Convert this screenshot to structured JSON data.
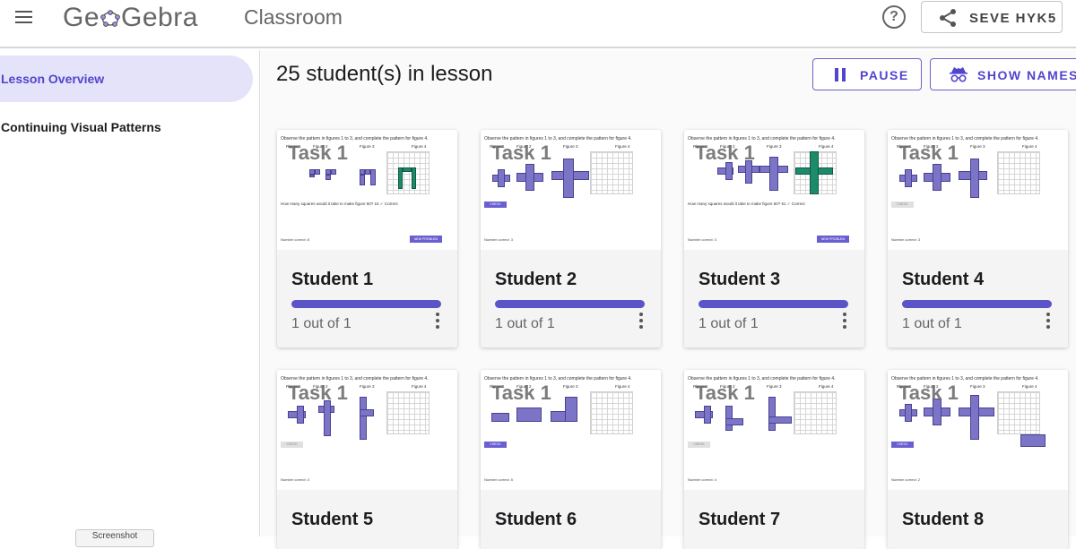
{
  "header": {
    "logo_left": "Ge",
    "logo_right": "Gebra",
    "product": "Classroom",
    "code_label": "SEVE HYK5",
    "help_glyph": "?"
  },
  "sidebar": {
    "items": [
      {
        "label": "Lesson Overview",
        "active": true
      },
      {
        "label": "Continuing Visual Patterns",
        "active": false
      }
    ],
    "stub_label": "Screenshot"
  },
  "main": {
    "title": "25 student(s) in lesson",
    "pause_label": "PAUSE",
    "names_label": "SHOW NAMES"
  },
  "thumbnail": {
    "task_label": "Task 1",
    "instructions": "Observe the pattern in figures 1 to 3, and complete the pattern for figure 4.",
    "figures": [
      "Figure 1",
      "Figure 2",
      "Figure 3",
      "Figure 4"
    ],
    "question": "How many squares would it take to make figure 50?",
    "correct_label": "✓ Correct",
    "check_label": "CHECK",
    "new_problem_label": "NEW PROBLEM",
    "number_correct": "Number correct:"
  },
  "students": [
    {
      "name": "Student 1",
      "score": "1 out of 1",
      "progress": 1.0,
      "answer": "15",
      "correct_count": "8"
    },
    {
      "name": "Student 2",
      "score": "1 out of 1",
      "progress": 1.0,
      "correct_count": "3"
    },
    {
      "name": "Student 3",
      "score": "1 out of 1",
      "progress": 1.0,
      "answer": "51",
      "correct_count": "3"
    },
    {
      "name": "Student 4",
      "score": "1 out of 1",
      "progress": 1.0,
      "correct_count": "3"
    },
    {
      "name": "Student 5",
      "correct_count": "3"
    },
    {
      "name": "Student 6",
      "correct_count": "5"
    },
    {
      "name": "Student 7",
      "correct_count": "4"
    },
    {
      "name": "Student 8",
      "correct_count": "2"
    }
  ],
  "colors": {
    "accent": "#5145cd",
    "active_nav_bg": "#e5e3f9",
    "shape_fill": "#7c74c6",
    "correct_green": "#1d8b6a"
  }
}
